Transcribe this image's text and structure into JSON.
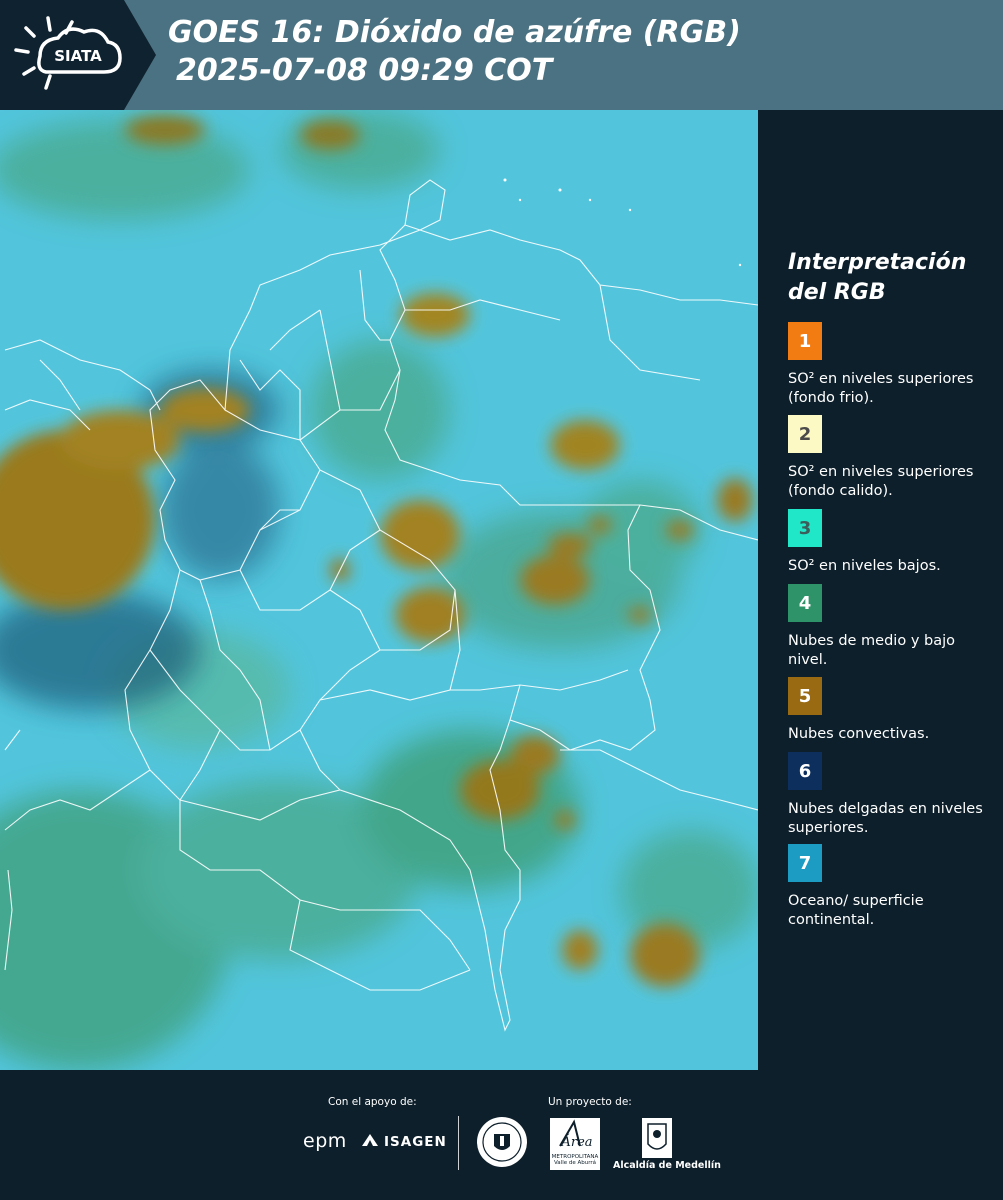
{
  "header": {
    "logo_text": "SIATA",
    "title_line1": "GOES 16: Dióxido de azúfre (RGB)",
    "title_line2": "2025-07-08 09:29 COT"
  },
  "legend": {
    "title_line1": "Interpretación",
    "title_line2": "del RGB",
    "items": [
      {
        "number": "1",
        "text": "SO² en niveles superiores (fondo frio).",
        "color": "#f37c12",
        "text_color": "#ffffff"
      },
      {
        "number": "2",
        "text": "SO² en niveles superiores (fondo calido).",
        "color": "#fdf9c4",
        "text_color": "#4a4a4a"
      },
      {
        "number": "3",
        "text": "SO² en niveles bajos.",
        "color": "#1fe7c8",
        "text_color": "#3b5e5a"
      },
      {
        "number": "4",
        "text": "Nubes de medio y bajo nivel.",
        "color": "#2f9369",
        "text_color": "#ffffff"
      },
      {
        "number": "5",
        "text": "Nubes convectivas.",
        "color": "#9a6a12",
        "text_color": "#ffffff"
      },
      {
        "number": "6",
        "text": "Nubes delgadas en niveles superiores.",
        "color": "#0d2f5e",
        "text_color": "#ffffff"
      },
      {
        "number": "7",
        "text": "Oceano/ superficie continental.",
        "color": "#1c9bc3",
        "text_color": "#ffffff"
      }
    ]
  },
  "footer": {
    "support_label": "Con el apoyo de:",
    "project_label": "Un proyecto de:",
    "epm_text": "epm",
    "isagen_text": "ISAGEN",
    "area_text": "Área",
    "area_sub": "METROPOLITANA Valle de Aburrá",
    "alcaldia_text": "Alcaldía de Medellín"
  },
  "map_colors": {
    "background": "#52c5dc",
    "convective": "#9a7a1c",
    "mid_low": "#3c9c70",
    "thin_high": "#1c5a78",
    "borders": "#ffffff"
  }
}
